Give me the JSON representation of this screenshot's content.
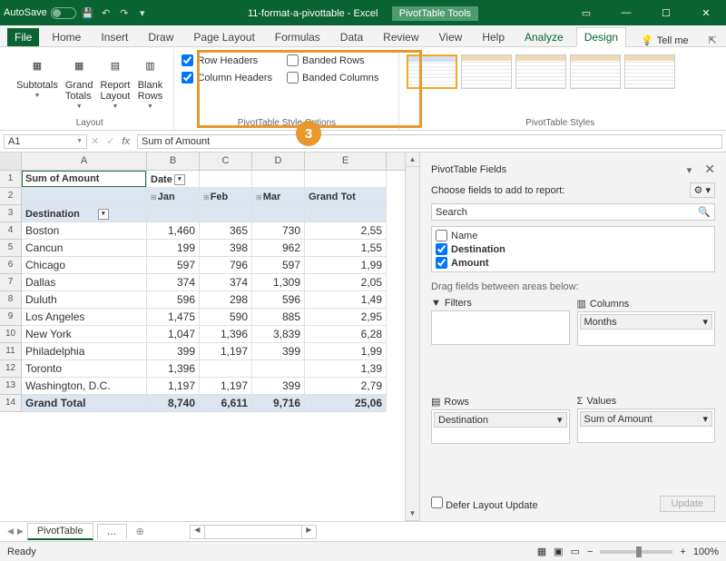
{
  "titlebar": {
    "autosave": "AutoSave",
    "filename": "11-format-a-pivottable - Excel",
    "toolgroup": "PivotTable Tools"
  },
  "tabs": {
    "file": "File",
    "list": [
      "Home",
      "Insert",
      "Draw",
      "Page Layout",
      "Formulas",
      "Data",
      "Review",
      "View",
      "Help"
    ],
    "ctx": [
      "Analyze",
      "Design"
    ],
    "active": "Design",
    "tellme": "Tell me"
  },
  "ribbon": {
    "layout": {
      "label": "Layout",
      "subtotals": "Subtotals",
      "grandtotals": "Grand\nTotals",
      "reportlayout": "Report\nLayout",
      "blankrows": "Blank\nRows"
    },
    "styleopt": {
      "label": "PivotTable Style Options",
      "rowheaders": "Row Headers",
      "colheaders": "Column Headers",
      "bandedrows": "Banded Rows",
      "bandedcols": "Banded Columns"
    },
    "styles": {
      "label": "PivotTable Styles"
    }
  },
  "callout": "3",
  "namebox": "A1",
  "formula": "Sum of Amount",
  "columns": [
    "A",
    "B",
    "C",
    "D",
    "E"
  ],
  "pivot": {
    "title": "Sum of Amount",
    "datefield": "Date",
    "rowfield": "Destination",
    "months": [
      "Jan",
      "Feb",
      "Mar"
    ],
    "grandtotcol": "Grand Tot",
    "rows": [
      {
        "n": "Boston",
        "v": [
          "1,460",
          "365",
          "730"
        ],
        "t": "2,55"
      },
      {
        "n": "Cancun",
        "v": [
          "199",
          "398",
          "962"
        ],
        "t": "1,55"
      },
      {
        "n": "Chicago",
        "v": [
          "597",
          "796",
          "597"
        ],
        "t": "1,99"
      },
      {
        "n": "Dallas",
        "v": [
          "374",
          "374",
          "1,309"
        ],
        "t": "2,05"
      },
      {
        "n": "Duluth",
        "v": [
          "596",
          "298",
          "596"
        ],
        "t": "1,49"
      },
      {
        "n": "Los Angeles",
        "v": [
          "1,475",
          "590",
          "885"
        ],
        "t": "2,95"
      },
      {
        "n": "New York",
        "v": [
          "1,047",
          "1,396",
          "3,839"
        ],
        "t": "6,28"
      },
      {
        "n": "Philadelphia",
        "v": [
          "399",
          "1,197",
          "399"
        ],
        "t": "1,99"
      },
      {
        "n": "Toronto",
        "v": [
          "1,396",
          "",
          ""
        ],
        "t": "1,39"
      },
      {
        "n": "Washington, D.C.",
        "v": [
          "1,197",
          "1,197",
          "399"
        ],
        "t": "2,79"
      }
    ],
    "grandtotrow": "Grand Total",
    "totals": [
      "8,740",
      "6,611",
      "9,716"
    ],
    "grandtotal": "25,06"
  },
  "taskpane": {
    "title": "PivotTable Fields",
    "sub": "Choose fields to add to report:",
    "search": "Search",
    "fields": [
      {
        "n": "Name",
        "c": false
      },
      {
        "n": "Destination",
        "c": true
      },
      {
        "n": "Amount",
        "c": true
      }
    ],
    "drag": "Drag fields between areas below:",
    "filters": "Filters",
    "columns": "Columns",
    "rows": "Rows",
    "values": "Values",
    "colitem": "Months",
    "rowitem": "Destination",
    "valitem": "Sum of Amount",
    "defer": "Defer Layout Update",
    "update": "Update"
  },
  "sheettab": "PivotTable",
  "status": {
    "ready": "Ready",
    "zoom": "100%"
  }
}
